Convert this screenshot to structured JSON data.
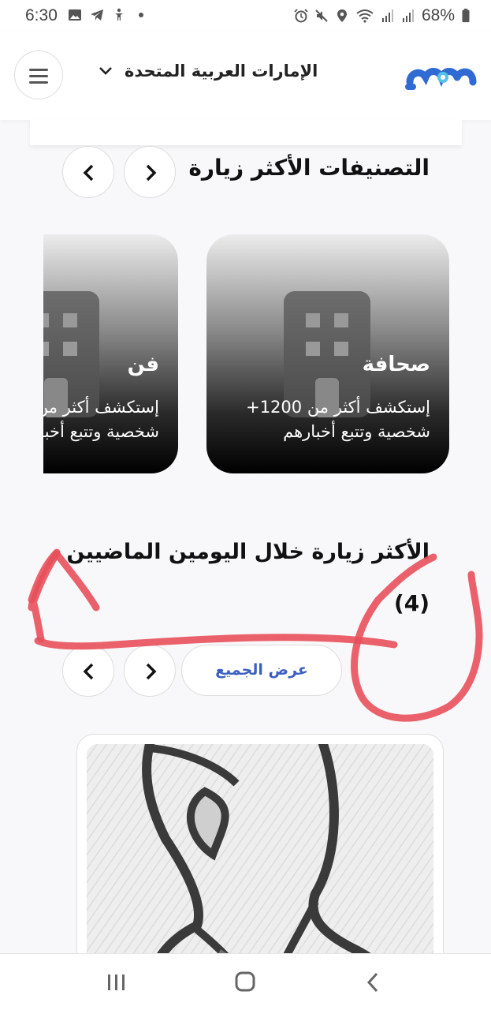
{
  "status_bar": {
    "time": "6:30",
    "battery": "68%",
    "left_icons": [
      "image-icon",
      "telegram-icon",
      "accessibility-icon",
      "dot-icon"
    ],
    "right_icons": [
      "alarm-icon",
      "mute-icon",
      "location-icon",
      "wifi-icon",
      "signal-icon",
      "signal-icon",
      "battery-icon"
    ]
  },
  "header": {
    "logo_icon": "mshahir-logo-icon",
    "country": "الإمارات العربية المتحدة",
    "menu_icon": "hamburger-menu-icon",
    "brand_color": "#2f6bd3"
  },
  "section_categories": {
    "title": "التصنيفات الأكثر زيارة",
    "cards": [
      {
        "name": "صحافة",
        "line1": "إستكشف أكثر من 1200+",
        "line2": "شخصية وتتبع أخبارهم"
      },
      {
        "name": "فن",
        "line1": "إستكشف أكثر من",
        "line2": "شخصية وتتبع أخبارهم"
      }
    ]
  },
  "section_most_visited": {
    "title": "الأكثر زيارة خلال اليومين الماضيين",
    "count": "(4)",
    "view_all": "عرض الجميع"
  },
  "annotation_color": "#e8505b"
}
